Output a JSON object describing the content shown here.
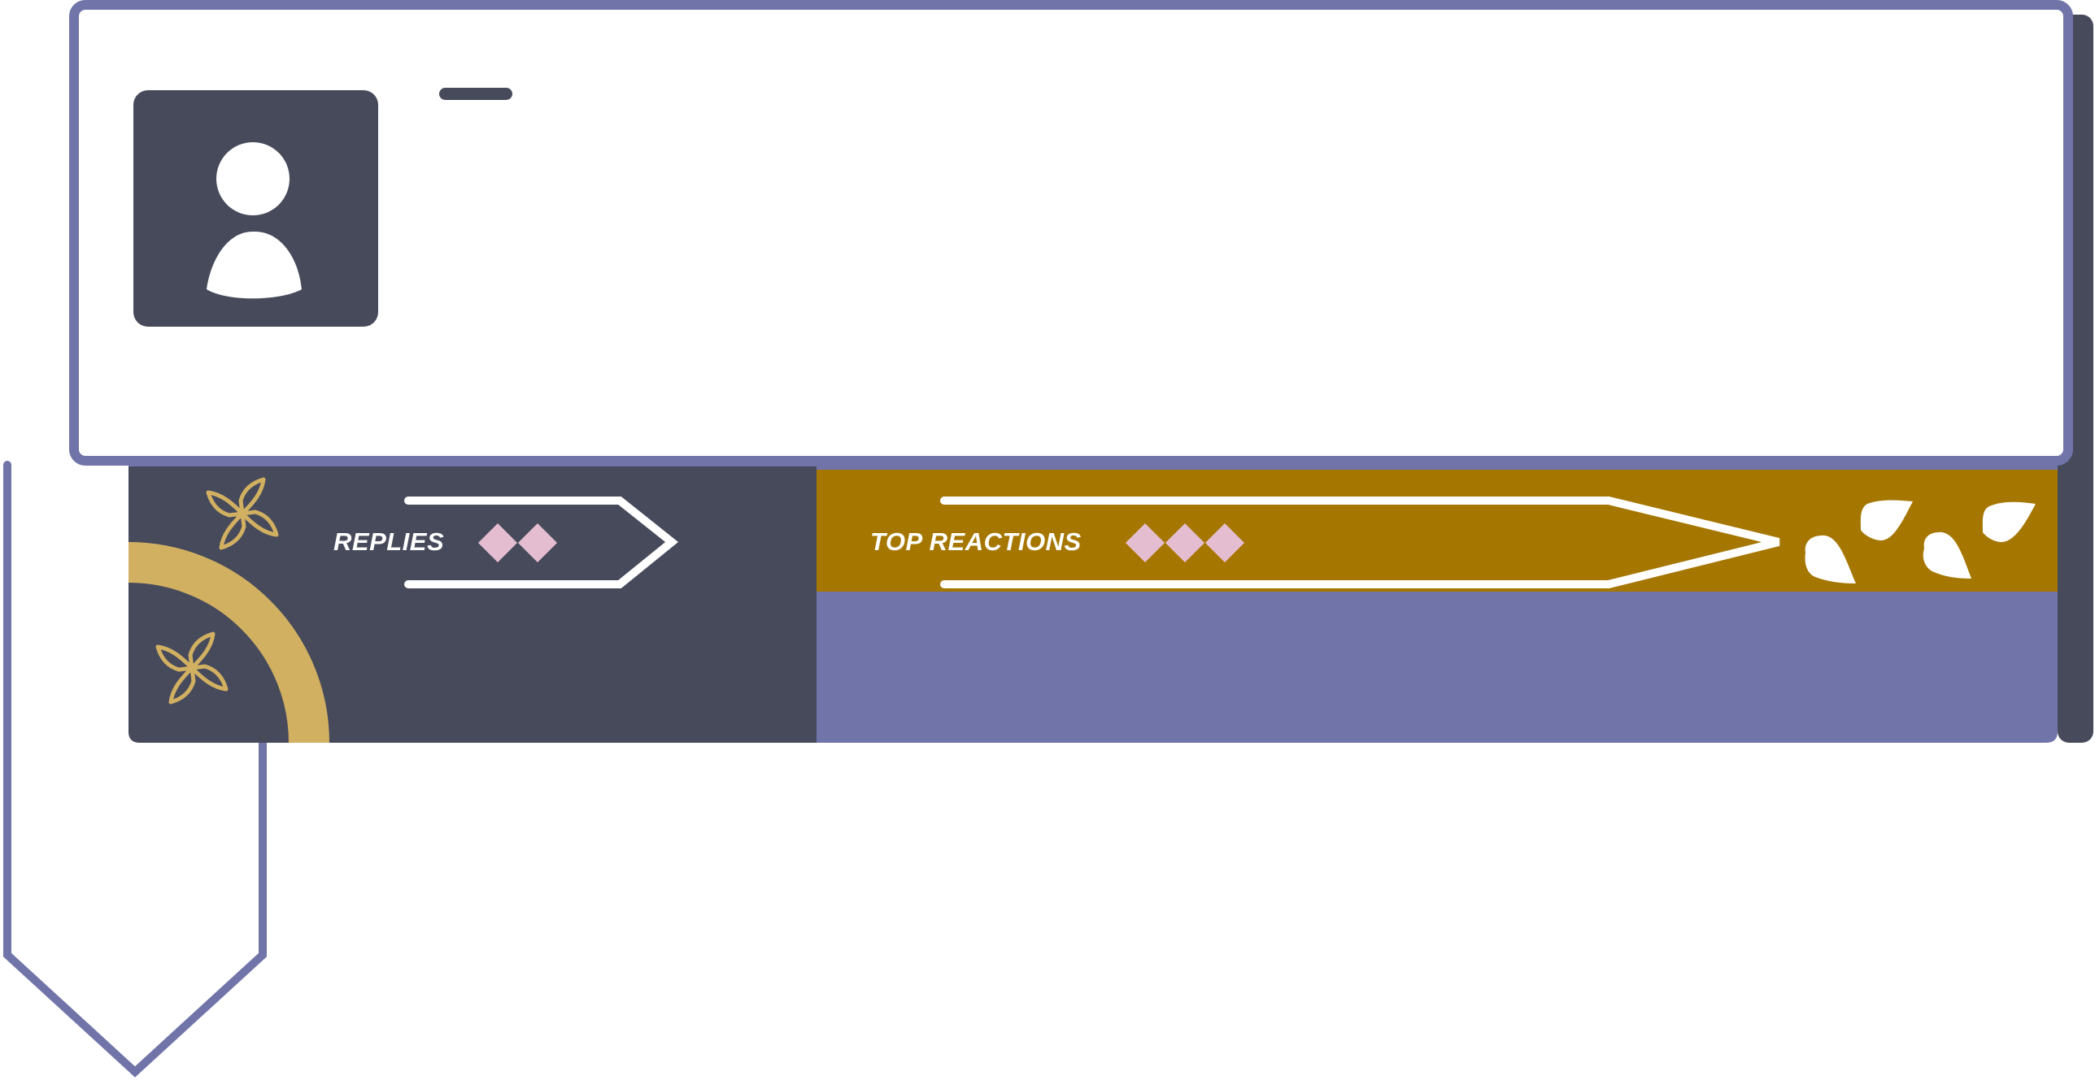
{
  "tabs": {
    "replies": {
      "label": "REPLIES"
    },
    "top_reactions": {
      "label": "TOP REACTIONS"
    }
  },
  "colors": {
    "primary_purple": "#7074a8",
    "dark_slate": "#474a5b",
    "mustard": "#a67700",
    "gold": "#d1b062",
    "pink": "#e4bdd0",
    "white": "#ffffff"
  },
  "icons": {
    "avatar": "user-silhouette-icon",
    "decor_flower": "four-petal-flower-icon",
    "reaction_teardrops": "teardrop-icon"
  }
}
